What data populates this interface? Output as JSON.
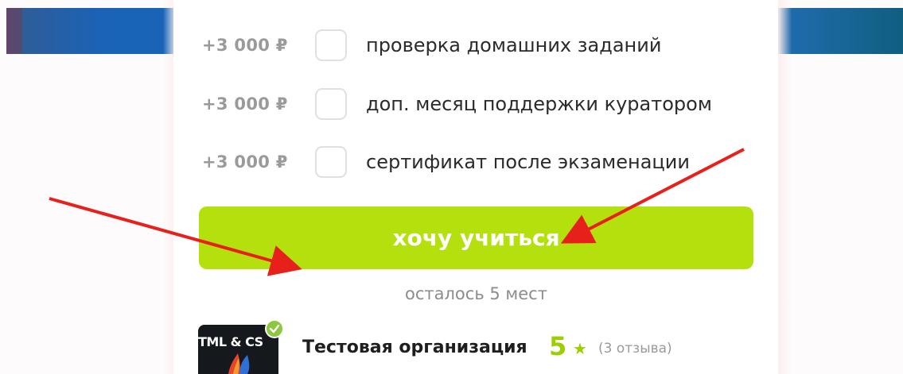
{
  "options": [
    {
      "price": "+3 000 ₽",
      "label": "проверка домашних заданий",
      "checked": false
    },
    {
      "price": "+3 000 ₽",
      "label": "доп. месяц поддержки куратором",
      "checked": false
    },
    {
      "price": "+3 000 ₽",
      "label": "сертификат после экзаменации",
      "checked": false
    }
  ],
  "cta": {
    "label": "хочу учиться"
  },
  "seats_left": "осталось 5 мест",
  "organization": {
    "logo_text": "TML & CS",
    "name": "Тестовая организация",
    "rating": "5",
    "rating_icon": "star-icon",
    "reviews": "(3 отзыва)"
  },
  "colors": {
    "accent_green": "#b4e10e",
    "rating_green": "#9bd000",
    "verified_green": "#8dc63f",
    "annotation_red": "#e8201b",
    "price_gray": "#9a9a9a"
  }
}
